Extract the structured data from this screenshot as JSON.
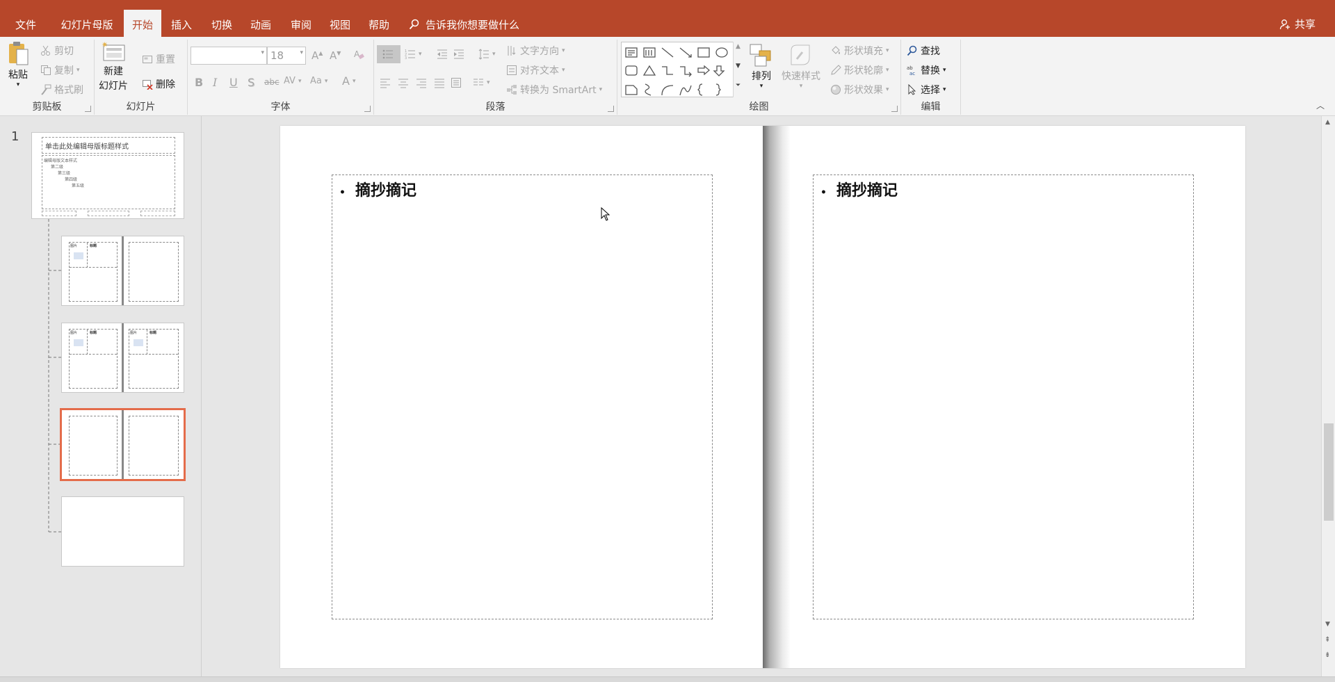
{
  "menu": {
    "tabs": [
      "文件",
      "幻灯片母版",
      "开始",
      "插入",
      "切换",
      "动画",
      "审阅",
      "视图",
      "帮助"
    ],
    "active_tab": "开始",
    "tellme": "告诉我你想要做什么",
    "share": "共享"
  },
  "ribbon": {
    "clipboard": {
      "label": "剪贴板",
      "paste": "粘贴",
      "cut": "剪切",
      "copy": "复制",
      "format_painter": "格式刷"
    },
    "slides": {
      "label": "幻灯片",
      "new_slide_line1": "新建",
      "new_slide_line2": "幻灯片",
      "reset": "重置",
      "delete": "删除"
    },
    "font": {
      "label": "字体",
      "font_name": "",
      "font_size": "18",
      "bold": "B",
      "italic": "I",
      "underline": "U",
      "shadow": "S",
      "strike": "abc",
      "spacing": "AV",
      "case": "Aa",
      "color": "A"
    },
    "paragraph": {
      "label": "段落",
      "text_direction": "文字方向",
      "align_text": "对齐文本",
      "smartart": "转换为 SmartArt"
    },
    "drawing": {
      "label": "绘图",
      "arrange": "排列",
      "quick_styles": "快速样式",
      "fill": "形状填充",
      "outline": "形状轮廓",
      "effects": "形状效果"
    },
    "editing": {
      "label": "编辑",
      "find": "查找",
      "replace": "替换",
      "select": "选择"
    }
  },
  "thumbnails": {
    "number": "1",
    "master_title": "单击此处编辑母版标题样式",
    "master_levels": [
      "编辑母版文本样式",
      "第二级",
      "第三级",
      "第四级",
      "第五级"
    ],
    "picture_label": "图片",
    "heading_label": "标题",
    "selected_index": 3
  },
  "slide": {
    "left_bullet": "摘抄摘记",
    "right_bullet": "摘抄摘记"
  },
  "colors": {
    "accent": "#b7472a",
    "selection": "#e46c4a",
    "ribbon": "#f3f3f3"
  }
}
